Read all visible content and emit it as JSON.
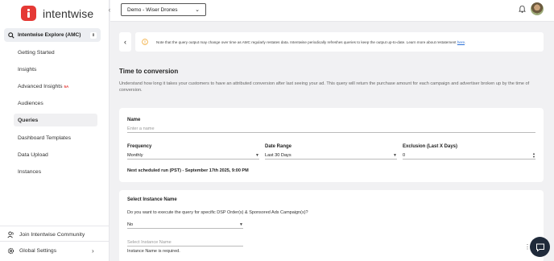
{
  "brand": {
    "name": "intentwise",
    "accent_color": "#e53935"
  },
  "topbar": {
    "account": "Demo - Wiser Drones"
  },
  "sidebar": {
    "product": "Intentwise Explore (AMC)",
    "items": [
      {
        "label": "Getting Started"
      },
      {
        "label": "Insights"
      },
      {
        "label": "Advanced Insights",
        "badge": "5A"
      },
      {
        "label": "Audiences"
      },
      {
        "label": "Queries"
      },
      {
        "label": "Dashboard Templates"
      },
      {
        "label": "Data Upload"
      },
      {
        "label": "Instances"
      }
    ],
    "community": "Join Intentwise Community",
    "settings": "Global Settings"
  },
  "notice": {
    "text": "Note that the query output may change over time as AMC regularly restates data. Intentwise periodically refreshes queries to keep the output up-to-date. Learn more about restatement ",
    "link": "here",
    "end": "."
  },
  "page": {
    "title": "Time to conversion",
    "description": "Understand how long it takes your customers to have an attributed conversion after last seeing your ad. This query will return the purchase amount for each campaign and advertiser broken up by the time of conversion."
  },
  "form": {
    "name_label": "Name",
    "name_placeholder": "Enter a name",
    "frequency_label": "Frequency",
    "frequency_value": "Monthly",
    "date_range_label": "Date Range",
    "date_range_value": "Last 30 Days",
    "exclusion_label": "Exclusion (Last X Days)",
    "exclusion_value": "0",
    "next_run": "Next scheduled run (PST) - September 17th 2025, 9:00 PM"
  },
  "instance": {
    "title": "Select Instance Name",
    "question": "Do you want to execute the query for specific DSP Order(s) & Sponsored Ads Campaign(s)?",
    "answer": "No",
    "instance_placeholder": "Select Instance Name",
    "error": "Instance Name is required."
  },
  "icons": [
    "chevron-left-icon",
    "chevron-down-icon",
    "bell-icon",
    "warning-icon",
    "users-icon",
    "gear-icon",
    "chat-icon",
    "drag-handle-icon",
    "search-icon"
  ]
}
